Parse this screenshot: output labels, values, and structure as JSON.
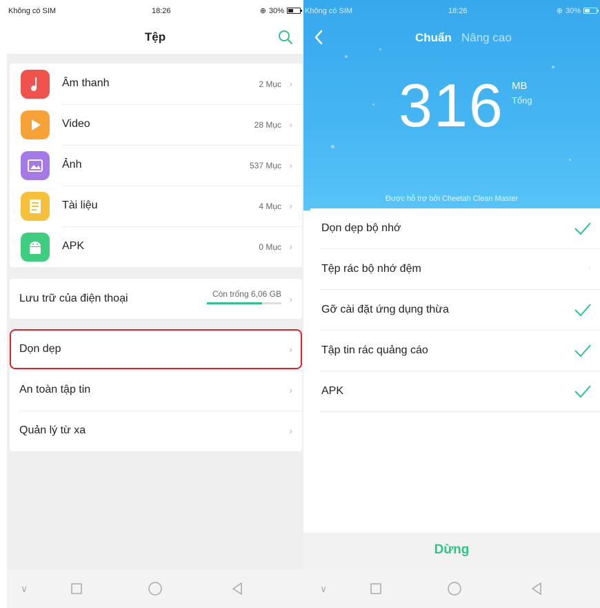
{
  "left": {
    "status": {
      "carrier": "Không có SIM",
      "time": "18:26",
      "battery": "30%"
    },
    "title": "Tệp",
    "categories": [
      {
        "label": "Âm thanh",
        "count": "2 Mục",
        "color": "#f0524d",
        "icon": "music-note-icon"
      },
      {
        "label": "Video",
        "count": "28 Mục",
        "color": "#f7a236",
        "icon": "play-icon"
      },
      {
        "label": "Ảnh",
        "count": "537 Mục",
        "color": "#a57ae6",
        "icon": "image-icon"
      },
      {
        "label": "Tài liệu",
        "count": "4 Mục",
        "color": "#f7c03a",
        "icon": "document-icon"
      },
      {
        "label": "APK",
        "count": "0 Mục",
        "color": "#3fce7f",
        "icon": "android-icon"
      }
    ],
    "storage": {
      "label": "Lưu trữ của điện thoại",
      "free": "Còn trống 6,06 GB",
      "used_fraction": 0.74
    },
    "menu": [
      {
        "label": "Dọn dẹp"
      },
      {
        "label": "An toàn tập tin"
      },
      {
        "label": "Quản lý từ xa"
      }
    ],
    "accent": "#2ec48a",
    "highlight_color": "#e0202a"
  },
  "right": {
    "status": {
      "carrier": "Không có SIM",
      "time": "18:26",
      "battery": "30%"
    },
    "tabs": {
      "active": "Chuẩn",
      "inactive": "Nâng cao"
    },
    "size": {
      "value": "316",
      "unit": "MB",
      "total_label": "Tổng"
    },
    "powered_by": "Được hỗ trợ bởi Cheetah Clean Master",
    "items": [
      {
        "label": "Dọn dẹp bộ nhớ",
        "checked": true
      },
      {
        "label": "Tệp rác bộ nhớ đệm",
        "checked": false
      },
      {
        "label": "Gỡ cài đặt ứng dụng thừa",
        "checked": true
      },
      {
        "label": "Tập tin rác quảng cáo",
        "checked": true
      },
      {
        "label": "APK",
        "checked": true
      }
    ],
    "stop_label": "Dừng",
    "header_color": "#3aaeef"
  }
}
